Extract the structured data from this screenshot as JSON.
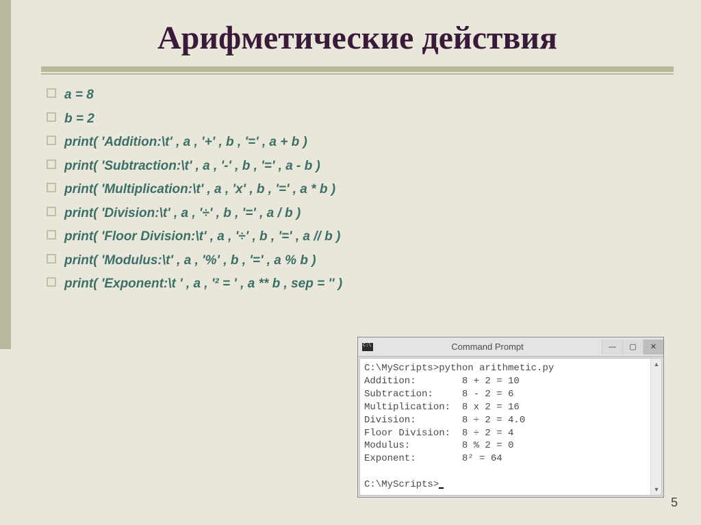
{
  "title": "Арифметические действия",
  "bullets": [
    "a = 8",
    "b = 2",
    "print( 'Addition:\\t' , a , '+' , b , '=' , a + b )",
    "print( 'Subtraction:\\t' , a , '-' , b , '=' , a - b )",
    "print( 'Multiplication:\\t' , a , 'x' , b , '=' , a * b )",
    "print( 'Division:\\t' , a , '÷' , b , '=' , a / b )",
    "print( 'Floor Division:\\t' , a , '÷' , b , '=' , a // b )",
    "print( 'Modulus:\\t' , a , '%' , b , '=' , a % b )",
    "print( 'Exponent:\\t ' , a , '² = ' , a ** b , sep = '' )"
  ],
  "cmd": {
    "window_title": "Command Prompt",
    "lines": [
      "C:\\MyScripts>python arithmetic.py",
      "Addition:        8 + 2 = 10",
      "Subtraction:     8 - 2 = 6",
      "Multiplication:  8 x 2 = 16",
      "Division:        8 ÷ 2 = 4.0",
      "Floor Division:  8 ÷ 2 = 4",
      "Modulus:         8 % 2 = 0",
      "Exponent:        8² = 64",
      "",
      "C:\\MyScripts>"
    ]
  },
  "page_number": "5"
}
